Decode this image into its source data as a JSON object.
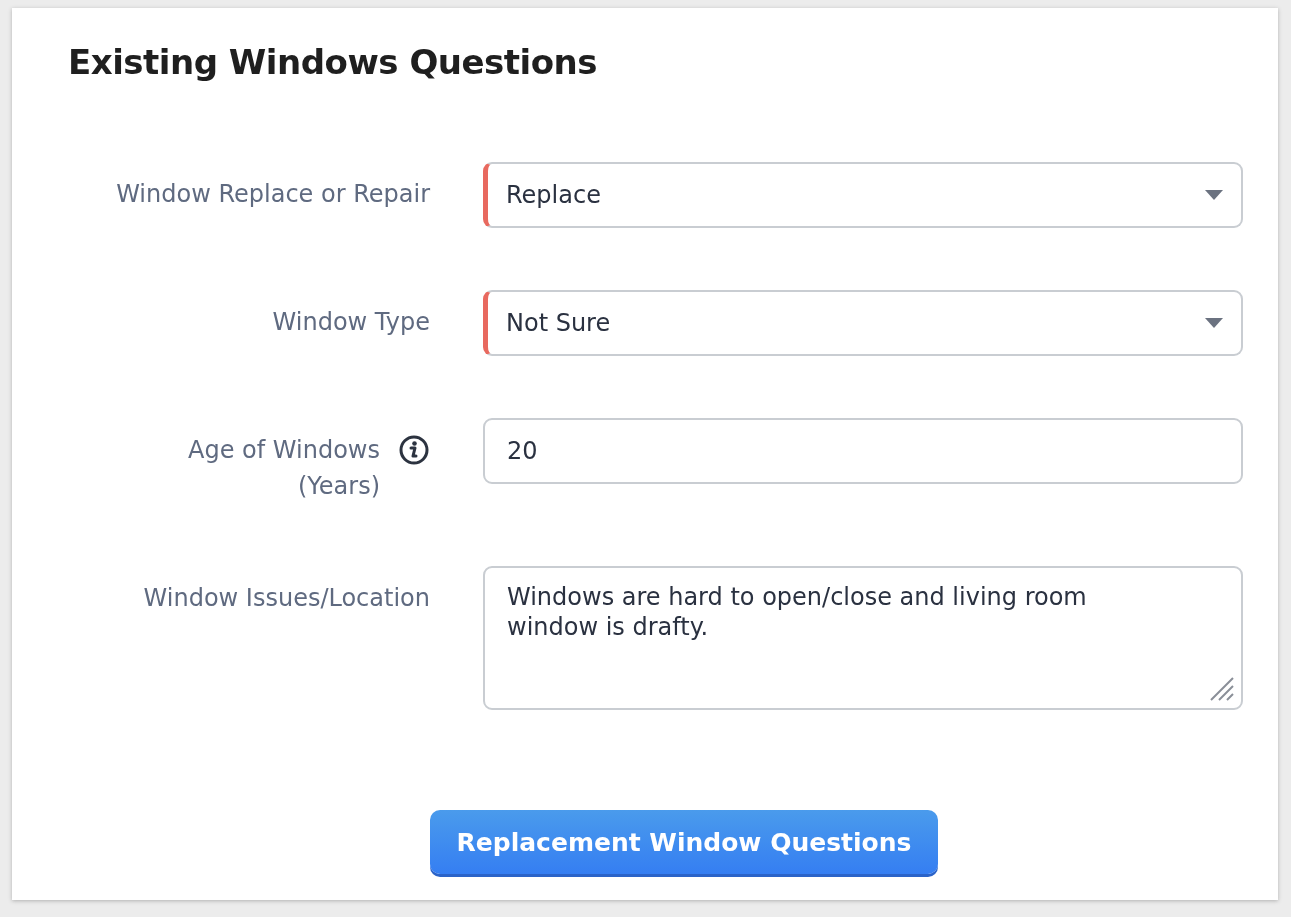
{
  "title": "Existing Windows Questions",
  "fields": [
    {
      "kind": "select",
      "label": "Window Replace or Repair",
      "value": "Replace",
      "required": true,
      "info": false
    },
    {
      "kind": "select",
      "label": "Window Type",
      "value": "Not Sure",
      "required": true,
      "info": false
    },
    {
      "kind": "text",
      "label": "Age of Windows (Years)",
      "value": "20",
      "required": false,
      "info": true
    },
    {
      "kind": "textarea",
      "label": "Window Issues/Location",
      "value": "Windows are hard to open/close and living room window is drafty.",
      "required": false,
      "info": false
    }
  ],
  "button": "Replacement Window Questions"
}
